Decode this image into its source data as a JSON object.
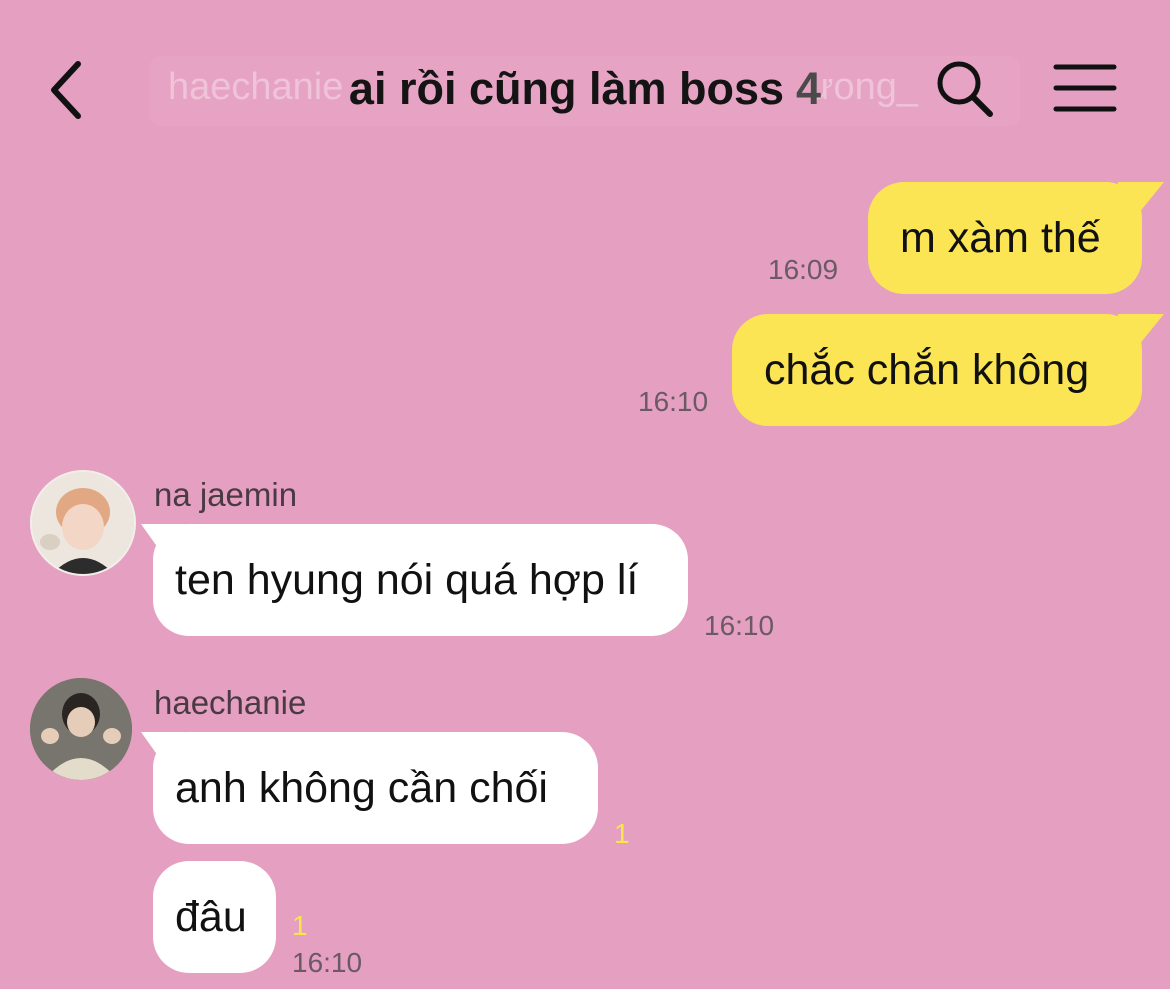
{
  "header": {
    "title": "ai rồi cũng làm boss",
    "member_count": "4",
    "ghost_text_left": "haechanie",
    "ghost_text_right": "ưong_"
  },
  "messages": [
    {
      "side": "mine",
      "text": "m xàm thế",
      "time": "16:09"
    },
    {
      "side": "mine",
      "text": "chắc chắn không",
      "time": "16:10"
    },
    {
      "side": "theirs",
      "sender": "na jaemin",
      "text": "ten hyung nói quá hợp lí",
      "time": "16:10"
    },
    {
      "side": "theirs",
      "sender": "haechanie",
      "text": "anh không cần chối",
      "unread": "1"
    },
    {
      "side": "theirs",
      "text": "đâu",
      "unread": "1",
      "time": "16:10"
    }
  ],
  "colors": {
    "background": "#e59fc0",
    "mine_bubble": "#fbe554",
    "their_bubble": "#ffffff",
    "unread": "#f7e64c"
  },
  "icons": {
    "back": "chevron-left-icon",
    "search": "search-icon",
    "menu": "hamburger-menu-icon"
  }
}
